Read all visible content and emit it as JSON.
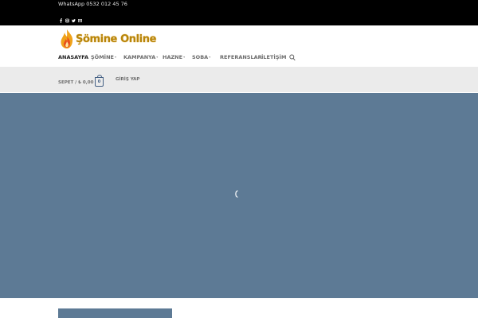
{
  "topbar": {
    "whatsapp_text": "WhatsApp 0532 012 45 76",
    "social_icons": [
      "facebook-icon",
      "instagram-icon",
      "twitter-icon",
      "email-icon"
    ]
  },
  "header": {
    "logo_text": "Şömine Online",
    "nav": {
      "items": [
        {
          "label": "ANASAYFA",
          "active": true,
          "dropdown": false
        },
        {
          "label": "ŞÖMİNE",
          "active": false,
          "dropdown": true
        },
        {
          "label": "KAMPANYA",
          "active": false,
          "dropdown": true
        },
        {
          "label": "HAZNE",
          "active": false,
          "dropdown": true
        },
        {
          "label": "SOBA",
          "active": false,
          "dropdown": true
        },
        {
          "label": "REFERANSLAR",
          "active": false,
          "dropdown": false
        },
        {
          "label": "İLETİŞİM",
          "active": false,
          "dropdown": false
        }
      ],
      "caret": "▾",
      "search_icon": "search-icon"
    }
  },
  "cartbar": {
    "cart_label": "SEPET / ₺ 0,00",
    "cart_count": "0",
    "login_label": "GİRİŞ YAP"
  },
  "hero": {
    "loader_glyph": "("
  },
  "colors": {
    "topbar_bg": "#000000",
    "cartbar_bg": "#ebebeb",
    "hero_bg": "#5d7a95",
    "accent": "#446084",
    "logo": "#b8860b"
  }
}
